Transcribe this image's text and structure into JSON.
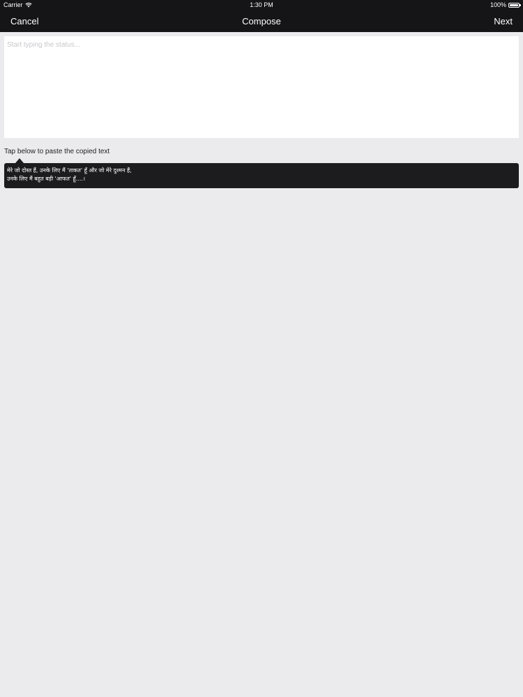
{
  "status_bar": {
    "carrier": "Carrier",
    "time": "1:30 PM",
    "battery": "100%",
    "wifi_icon": "wifi-icon",
    "battery_icon": "battery-icon"
  },
  "nav": {
    "cancel_label": "Cancel",
    "title": "Compose",
    "next_label": "Next"
  },
  "compose": {
    "placeholder": "Start typing the status...",
    "value": ""
  },
  "paste": {
    "hint": "Tap below to paste the copied text",
    "clipboard_lines": [
      "मेरे जो दोस्त हैं, उनके लिए मैं 'ताकत' हूँ और जो मेरे दुश्मन हैं,",
      "उनके लिए मैं बहुत बड़ी 'आफत' हूँ....।"
    ]
  },
  "colors": {
    "bar_background": "#151518",
    "page_background": "#ebebee",
    "clipboard_background": "#1c1c1f"
  }
}
